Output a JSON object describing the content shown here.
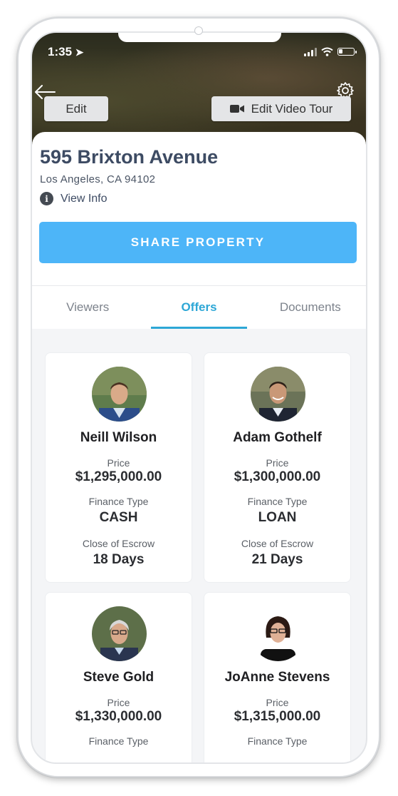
{
  "status": {
    "time": "1:35"
  },
  "header": {
    "edit_label": "Edit",
    "video_tour_label": "Edit Video Tour"
  },
  "property": {
    "title": "595 Brixton Avenue",
    "address": "Los Angeles, CA 94102",
    "view_info_label": "View Info",
    "share_label": "SHARE PROPERTY"
  },
  "tabs": [
    {
      "label": "Viewers",
      "active": false
    },
    {
      "label": "Offers",
      "active": true
    },
    {
      "label": "Documents",
      "active": false
    }
  ],
  "offers": [
    {
      "name": "Neill Wilson",
      "price_label": "Price",
      "price": "$1,295,000.00",
      "finance_label": "Finance Type",
      "finance": "CASH",
      "escrow_label": "Close of Escrow",
      "escrow": "18 Days"
    },
    {
      "name": "Adam Gothelf",
      "price_label": "Price",
      "price": "$1,300,000.00",
      "finance_label": "Finance Type",
      "finance": "LOAN",
      "escrow_label": "Close of Escrow",
      "escrow": "21 Days"
    },
    {
      "name": "Steve Gold",
      "price_label": "Price",
      "price": "$1,330,000.00",
      "finance_label": "Finance Type"
    },
    {
      "name": "JoAnne Stevens",
      "price_label": "Price",
      "price": "$1,315,000.00",
      "finance_label": "Finance Type"
    }
  ],
  "colors": {
    "accent": "#2da7d6",
    "share_button": "#4db5f8",
    "title": "#3d4b63"
  }
}
